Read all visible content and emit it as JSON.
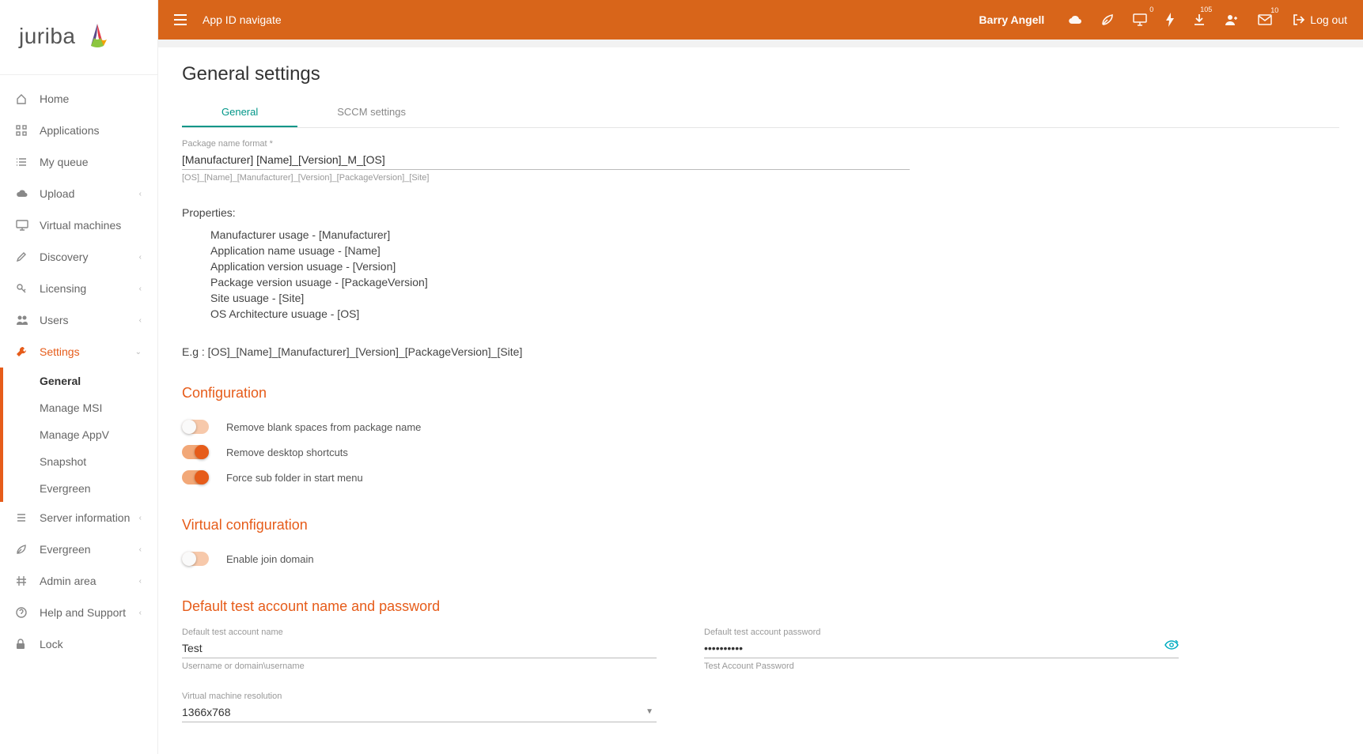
{
  "logo_text": "juriba",
  "header": {
    "breadcrumb": "App ID navigate",
    "user_name": "Barry Angell",
    "badges": {
      "monitor": "0",
      "download": "105",
      "mail": "10"
    },
    "logout": "Log out"
  },
  "sidebar": {
    "items": [
      {
        "icon": "home",
        "label": "Home",
        "expandable": false
      },
      {
        "icon": "grid",
        "label": "Applications",
        "expandable": false
      },
      {
        "icon": "list",
        "label": "My queue",
        "expandable": false
      },
      {
        "icon": "cloud-up",
        "label": "Upload",
        "expandable": true
      },
      {
        "icon": "monitor",
        "label": "Virtual machines",
        "expandable": false
      },
      {
        "icon": "pencil",
        "label": "Discovery",
        "expandable": true
      },
      {
        "icon": "key",
        "label": "Licensing",
        "expandable": true
      },
      {
        "icon": "users",
        "label": "Users",
        "expandable": true
      },
      {
        "icon": "wrench",
        "label": "Settings",
        "expandable": true,
        "active": true,
        "expanded": true
      },
      {
        "icon": "list2",
        "label": "Server information",
        "expandable": true
      },
      {
        "icon": "leaf",
        "label": "Evergreen",
        "expandable": true
      },
      {
        "icon": "hash",
        "label": "Admin area",
        "expandable": true
      },
      {
        "icon": "help",
        "label": "Help and Support",
        "expandable": true
      },
      {
        "icon": "lock",
        "label": "Lock",
        "expandable": false
      }
    ],
    "settings_sub": [
      {
        "label": "General",
        "active": true
      },
      {
        "label": "Manage MSI"
      },
      {
        "label": "Manage AppV"
      },
      {
        "label": "Snapshot"
      },
      {
        "label": "Evergreen"
      }
    ]
  },
  "page": {
    "title": "General settings",
    "tabs": [
      {
        "label": "General",
        "active": true
      },
      {
        "label": "SCCM settings"
      }
    ],
    "package_name_format": {
      "label": "Package name format *",
      "value": "[Manufacturer] [Name]_[Version]_M_[OS]",
      "hint": "[OS]_[Name]_[Manufacturer]_[Version]_[PackageVersion]_[Site]"
    },
    "properties_heading": "Properties:",
    "properties": [
      "Manufacturer usage - [Manufacturer]",
      "Application name usuage - [Name]",
      "Application version usuage - [Version]",
      "Package version usuage - [PackageVersion]",
      "Site usuage - [Site]",
      "OS Architecture usuage - [OS]"
    ],
    "example": "E.g : [OS]_[Name]_[Manufacturer]_[Version]_[PackageVersion]_[Site]",
    "configuration": {
      "heading": "Configuration",
      "toggles": [
        {
          "label": "Remove blank spaces from package name",
          "on": false
        },
        {
          "label": "Remove desktop shortcuts",
          "on": true
        },
        {
          "label": "Force sub folder in start menu",
          "on": true
        }
      ]
    },
    "virtual_config": {
      "heading": "Virtual configuration",
      "toggles": [
        {
          "label": "Enable join domain",
          "on": false
        }
      ]
    },
    "test_account": {
      "heading": "Default test account name and password",
      "name_label": "Default test account name",
      "name_value": "Test",
      "name_hint": "Username or domain\\username",
      "password_label": "Default test account password",
      "password_value": "••••••••••",
      "password_hint": "Test Account Password"
    },
    "vm_resolution": {
      "label": "Virtual machine resolution",
      "value": "1366x768"
    }
  }
}
